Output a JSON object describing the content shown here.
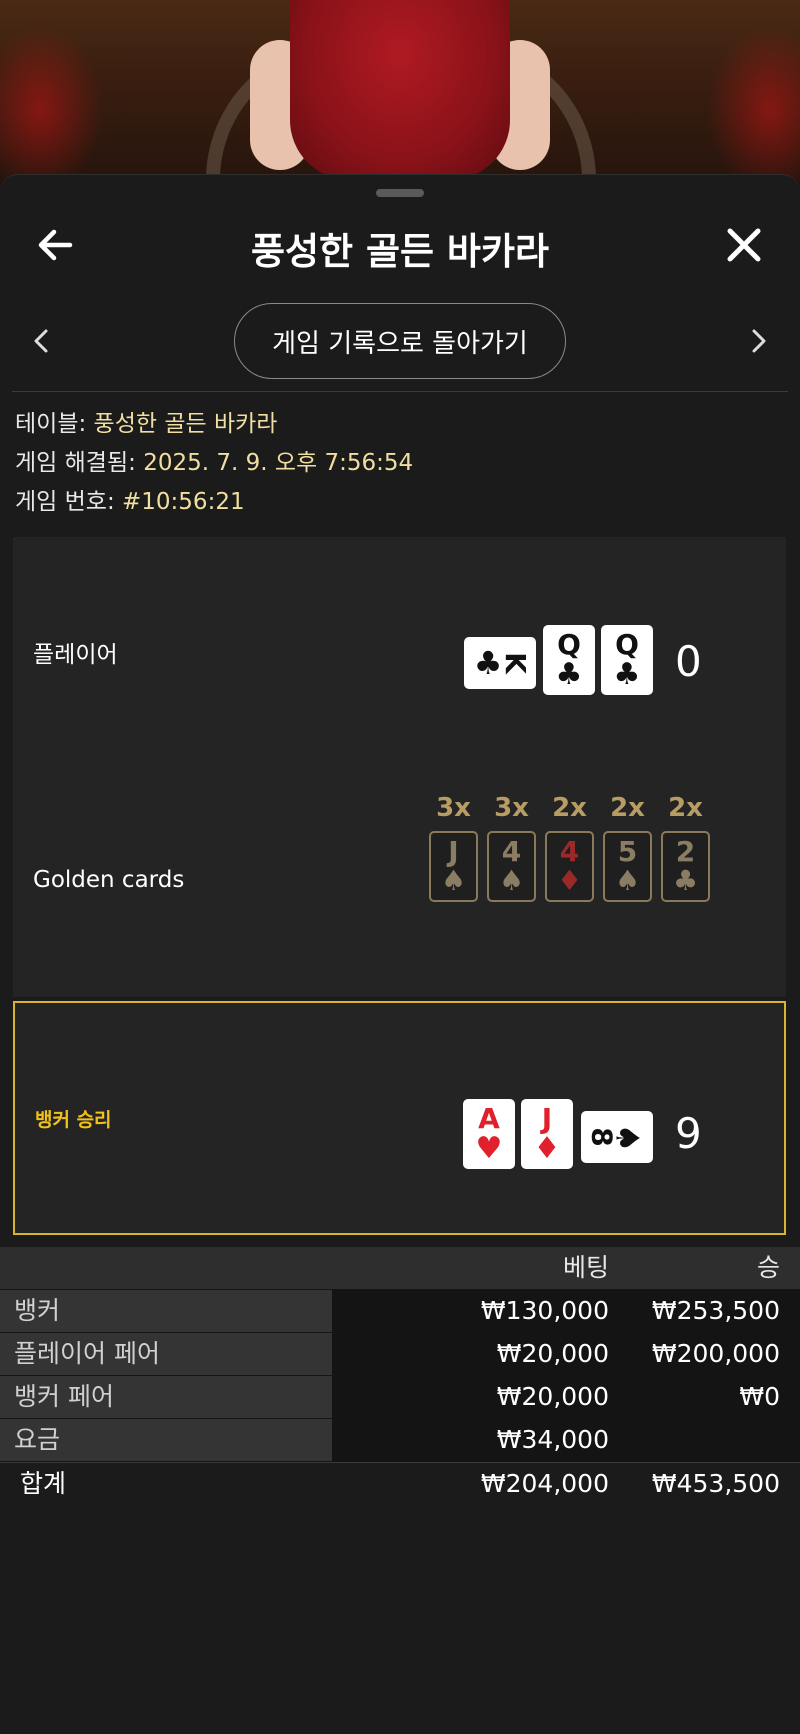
{
  "header": {
    "title": "풍성한 골든 바카라"
  },
  "nav": {
    "history_button_label": "게임 기록으로 돌아가기"
  },
  "info": {
    "table_label": "테이블:",
    "table_value": "풍성한 골든 바카라",
    "resolved_label": "게임 해결됨:",
    "resolved_value": "2025. 7. 9. 오후 7:56:54",
    "game_number_label": "게임 번호:",
    "game_number_value": "#10:56:21"
  },
  "player": {
    "label": "플레이어",
    "cards": [
      {
        "rank": "K",
        "suit": "♣",
        "color": "black",
        "orientation": "horizontal"
      },
      {
        "rank": "Q",
        "suit": "♣",
        "color": "black",
        "orientation": "vertical"
      },
      {
        "rank": "Q",
        "suit": "♣",
        "color": "black",
        "orientation": "vertical"
      }
    ],
    "score": "0"
  },
  "golden": {
    "label": "Golden cards",
    "cards": [
      {
        "mult": "3x",
        "rank": "J",
        "suit": "♠",
        "color": "black"
      },
      {
        "mult": "3x",
        "rank": "4",
        "suit": "♠",
        "color": "black"
      },
      {
        "mult": "2x",
        "rank": "4",
        "suit": "♦",
        "color": "red"
      },
      {
        "mult": "2x",
        "rank": "5",
        "suit": "♠",
        "color": "black"
      },
      {
        "mult": "2x",
        "rank": "2",
        "suit": "♣",
        "color": "black"
      }
    ]
  },
  "banker": {
    "label": "뱅커 승리",
    "label_color": "#f2c21b",
    "cards": [
      {
        "rank": "A",
        "suit": "♥",
        "color": "red",
        "orientation": "vertical"
      },
      {
        "rank": "J",
        "suit": "♦",
        "color": "red",
        "orientation": "vertical"
      },
      {
        "rank": "8",
        "suit": "♠",
        "color": "black",
        "orientation": "horizontal"
      }
    ],
    "score": "9"
  },
  "bets": {
    "headers": {
      "bet": "베팅",
      "win": "승"
    },
    "rows": [
      {
        "name": "뱅커",
        "bet": "₩130,000",
        "win": "₩253,500"
      },
      {
        "name": "플레이어 페어",
        "bet": "₩20,000",
        "win": "₩200,000"
      },
      {
        "name": "뱅커 페어",
        "bet": "₩20,000",
        "win": "₩0"
      },
      {
        "name": "요금",
        "bet": "₩34,000",
        "win": ""
      }
    ],
    "total": {
      "name": "합계",
      "bet": "₩204,000",
      "win": "₩453,500"
    }
  },
  "colors": {
    "accent_gold": "#d8b52c",
    "info_value": "#f0dfa0",
    "sheet_bg": "#1b1b1b"
  },
  "icons": {
    "back": "arrow-left-icon",
    "close": "close-icon",
    "prev": "chevron-left-icon",
    "next": "chevron-right-icon"
  }
}
